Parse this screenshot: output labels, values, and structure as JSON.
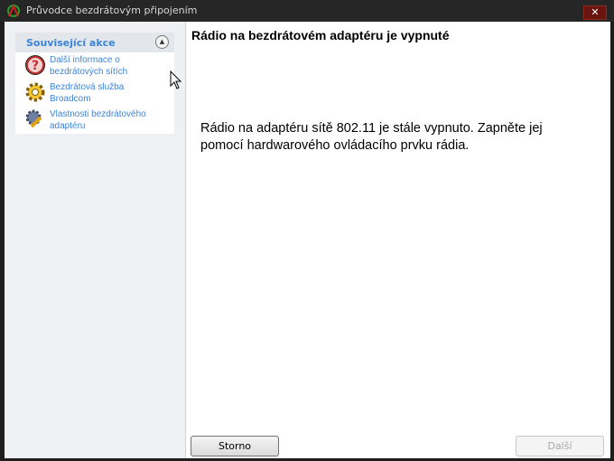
{
  "window": {
    "title": "Průvodce bezdrátovým připojením",
    "close_label": "✕"
  },
  "sidebar": {
    "title": "Související akce",
    "items": [
      {
        "label_1": "Další informace o",
        "label_2": "bezdrátových sítích",
        "icon": "help-icon"
      },
      {
        "label_1": "Bezdrátová služba",
        "label_2": "Broadcom",
        "icon": "gear-icon"
      },
      {
        "label_1": "Vlastnosti bezdrátového",
        "label_2": "adaptéru",
        "icon": "settings-wrench-icon"
      }
    ]
  },
  "main": {
    "heading": "Rádio na bezdrátovém adaptéru je vypnuté",
    "message": "Rádio na adaptéru sítě 802.11 je stále vypnuto. Zapněte jej pomocí hardwarového ovládacího prvku rádia."
  },
  "buttons": {
    "cancel": "Storno",
    "next": "Další"
  }
}
